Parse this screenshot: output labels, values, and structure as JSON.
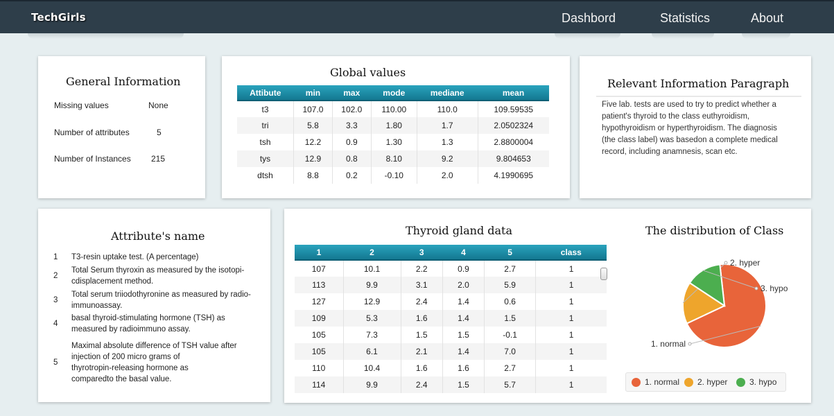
{
  "brand": "TechGirls",
  "nav": {
    "dashboard": "Dashbord",
    "statistics": "Statistics",
    "about": "About"
  },
  "general_info": {
    "title": "General Information",
    "rows": [
      {
        "label": "Missing values",
        "value": "None"
      },
      {
        "label": "Number of attributes",
        "value": "5"
      },
      {
        "label": "Number of Instances",
        "value": "215"
      }
    ]
  },
  "global_values": {
    "title": "Global values",
    "headers": [
      "Attibute",
      "min",
      "max",
      "mode",
      "mediane",
      "mean"
    ],
    "rows": [
      [
        "t3",
        "107.0",
        "102.0",
        "110.00",
        "110.0",
        "109.59535"
      ],
      [
        "tri",
        "5.8",
        "3.3",
        "1.80",
        "1.7",
        "2.0502324"
      ],
      [
        "tsh",
        "12.2",
        "0.9",
        "1.30",
        "1.3",
        "2.8800004"
      ],
      [
        "tys",
        "12.9",
        "0.8",
        "8.10",
        "9.2",
        "9.804653"
      ],
      [
        "dtsh",
        "8.8",
        "0.2",
        "-0.10",
        "2.0",
        "4.1990695"
      ]
    ]
  },
  "relevant_info": {
    "title": "Relevant Information Paragraph",
    "lines": [
      "Five lab. tests are used to try to predict whether a",
      "patient's thyroid to the class euthyroidism,",
      "hypothyroidism or hyperthyroidism. The diagnosis",
      "(the class label) was basedon a complete medical",
      "record, including anamnesis, scan etc."
    ]
  },
  "attributes": {
    "title": "Attribute's name",
    "items": [
      {
        "num": "1",
        "lines": [
          "T3-resin uptake test. (A percentage)"
        ]
      },
      {
        "num": "2",
        "lines": [
          "Total Serum thyroxin as measured by the isotopi-",
          "cdisplacement method."
        ]
      },
      {
        "num": "3",
        "lines": [
          "Total serum triiodothyronine as measured by radio-",
          "immunoassay."
        ]
      },
      {
        "num": "4",
        "lines": [
          "basal thyroid-stimulating hormone (TSH) as",
          "measured by radioimmuno assay."
        ]
      },
      {
        "num": "5",
        "lines": [
          "Maximal absolute difference of TSH value after",
          "injection of 200 micro grams of",
          "thyrotropin-releasing hormone as",
          "comparedto the basal value."
        ]
      }
    ]
  },
  "thyroid": {
    "title": "Thyroid gland data",
    "headers": [
      "1",
      "2",
      "3",
      "4",
      "5",
      "class"
    ],
    "rows": [
      [
        "107",
        "10.1",
        "2.2",
        "0.9",
        "2.7",
        "1"
      ],
      [
        "113",
        "9.9",
        "3.1",
        "2.0",
        "5.9",
        "1"
      ],
      [
        "127",
        "12.9",
        "2.4",
        "1.4",
        "0.6",
        "1"
      ],
      [
        "109",
        "5.3",
        "1.6",
        "1.4",
        "1.5",
        "1"
      ],
      [
        "105",
        "7.3",
        "1.5",
        "1.5",
        "-0.1",
        "1"
      ],
      [
        "105",
        "6.1",
        "2.1",
        "1.4",
        "7.0",
        "1"
      ],
      [
        "110",
        "10.4",
        "1.6",
        "1.6",
        "2.7",
        "1"
      ],
      [
        "114",
        "9.9",
        "2.4",
        "1.5",
        "5.7",
        "1"
      ]
    ]
  },
  "chart_data": {
    "type": "pie",
    "title": "The distribution of Class",
    "categories": [
      "1. normal",
      "2. hyper",
      "3. hypo"
    ],
    "values": [
      150,
      35,
      30
    ],
    "colors": [
      "#e8643a",
      "#eea52c",
      "#4cae4f"
    ],
    "legend_position": "bottom"
  }
}
